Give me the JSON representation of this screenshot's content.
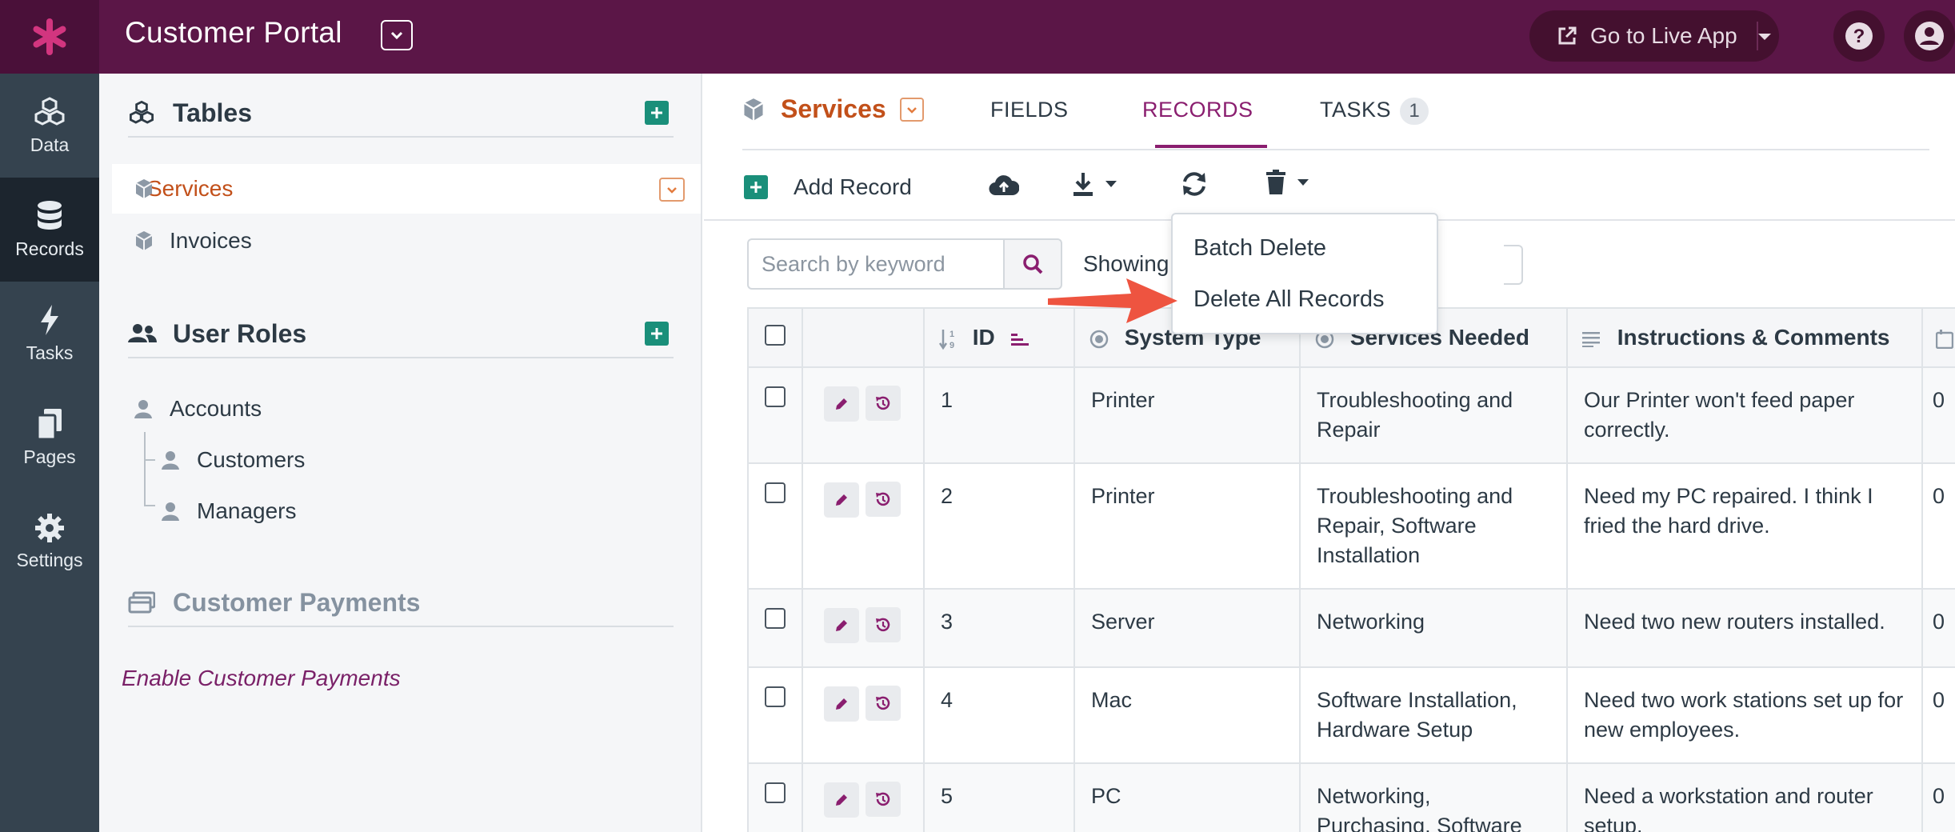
{
  "header": {
    "app_title": "Customer Portal",
    "live_button_label": "Go to Live App",
    "brand_color": "#5b1647"
  },
  "rail": {
    "items": [
      {
        "label": "Data",
        "icon": "cubes-icon"
      },
      {
        "label": "Records",
        "icon": "database-icon",
        "active": true
      },
      {
        "label": "Tasks",
        "icon": "bolt-icon"
      },
      {
        "label": "Pages",
        "icon": "pages-icon"
      },
      {
        "label": "Settings",
        "icon": "gear-icon"
      }
    ]
  },
  "panel": {
    "tables_heading": "Tables",
    "tables": [
      {
        "label": "Services",
        "selected": true
      },
      {
        "label": "Invoices"
      }
    ],
    "roles_heading": "User Roles",
    "roles": [
      {
        "label": "Accounts"
      },
      {
        "label": "Customers"
      },
      {
        "label": "Managers"
      }
    ],
    "payments_heading": "Customer Payments",
    "enable_payments_link": "Enable Customer Payments"
  },
  "main": {
    "table_title": "Services",
    "tabs": [
      {
        "label": "FIELDS"
      },
      {
        "label": "RECORDS",
        "active": true
      },
      {
        "label": "TASKS",
        "badge": "1"
      }
    ],
    "toolbar": {
      "add_record_label": "Add Record"
    },
    "search": {
      "placeholder": "Search by keyword"
    },
    "showing_text": "Showing",
    "delete_menu": {
      "items": [
        "Batch Delete",
        "Delete All Records"
      ]
    },
    "columns": [
      "ID",
      "System Type",
      "Services Needed",
      "Instructions & Comments"
    ],
    "rows": [
      {
        "id": "1",
        "system": "Printer",
        "services": "Troubleshooting and Repair",
        "comments": "Our Printer won't feed paper correctly.",
        "next": "0"
      },
      {
        "id": "2",
        "system": "Printer",
        "services": "Troubleshooting and Repair, Software Installation",
        "comments": "Need my PC repaired. I think I fried the hard drive.",
        "next": "0"
      },
      {
        "id": "3",
        "system": "Server",
        "services": "Networking",
        "comments": "Need two new routers installed.",
        "next": "0"
      },
      {
        "id": "4",
        "system": "Mac",
        "services": "Software Installation, Hardware Setup",
        "comments": "Need two work stations set up for new employees.",
        "next": "0"
      },
      {
        "id": "5",
        "system": "PC",
        "services": "Networking, Purchasing, Software",
        "comments": "Need a workstation and router setup.",
        "next": "0"
      }
    ]
  },
  "colors": {
    "accent_orange": "#c2501a",
    "accent_purple": "#8a1e6f",
    "add_green": "#1a8f7a",
    "arrow_red": "#ee5440"
  }
}
